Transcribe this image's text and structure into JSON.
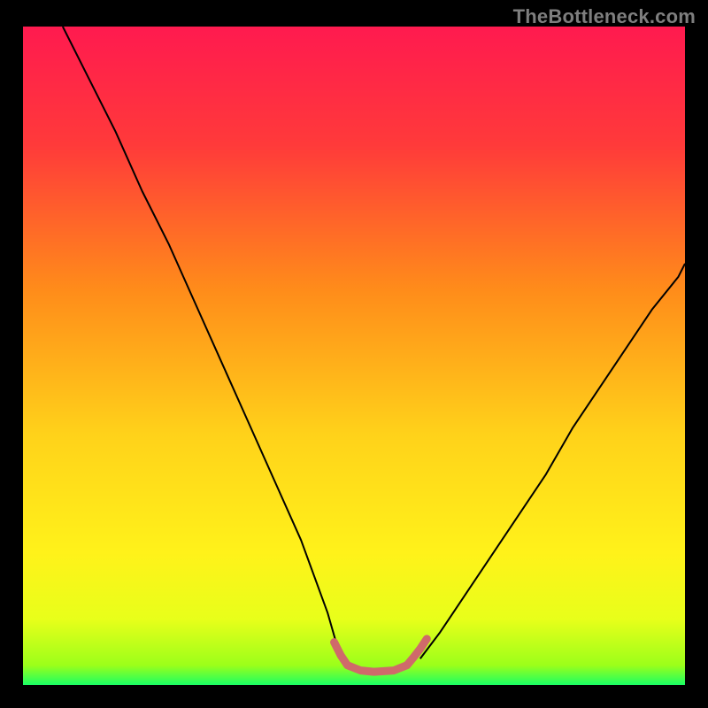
{
  "watermark": "TheBottleneck.com",
  "chart_data": {
    "type": "line",
    "title": "",
    "xlabel": "",
    "ylabel": "",
    "xlim": [
      0,
      100
    ],
    "ylim": [
      0,
      100
    ],
    "grid": false,
    "legend": null,
    "background_gradient": {
      "stops": [
        {
          "offset": 0,
          "color": "#ff1a4f"
        },
        {
          "offset": 0.18,
          "color": "#ff3a3a"
        },
        {
          "offset": 0.4,
          "color": "#ff8c1a"
        },
        {
          "offset": 0.62,
          "color": "#ffd21a"
        },
        {
          "offset": 0.8,
          "color": "#fff21a"
        },
        {
          "offset": 0.9,
          "color": "#e8ff1a"
        },
        {
          "offset": 0.97,
          "color": "#9cff1a"
        },
        {
          "offset": 1.0,
          "color": "#1aff64"
        }
      ]
    },
    "series": [
      {
        "name": "curve-left",
        "type": "line",
        "color": "#000000",
        "width": 2,
        "x": [
          6,
          10,
          14,
          18,
          22,
          26,
          30,
          34,
          38,
          42,
          46,
          48
        ],
        "y": [
          100,
          92,
          84,
          75,
          67,
          58,
          49,
          40,
          31,
          22,
          11,
          4
        ]
      },
      {
        "name": "curve-right",
        "type": "line",
        "color": "#000000",
        "width": 2,
        "x": [
          60,
          63,
          67,
          71,
          75,
          79,
          83,
          87,
          91,
          95,
          99,
          100
        ],
        "y": [
          4,
          8,
          14,
          20,
          26,
          32,
          39,
          45,
          51,
          57,
          62,
          64
        ]
      },
      {
        "name": "valley-highlight",
        "type": "line",
        "color": "#cf6a6a",
        "width": 9,
        "linecap": "round",
        "x": [
          47,
          48,
          49,
          51,
          53,
          56,
          58,
          59,
          60,
          61
        ],
        "y": [
          6.5,
          4.5,
          3,
          2.2,
          2,
          2.2,
          3,
          4.2,
          5.5,
          7
        ]
      }
    ]
  }
}
